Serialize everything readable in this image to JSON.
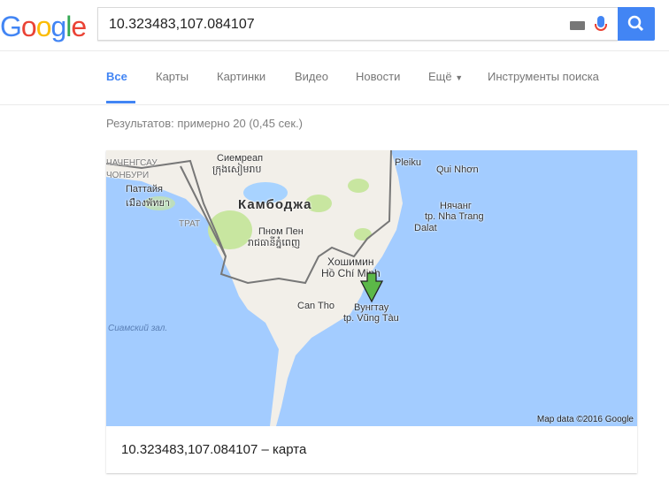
{
  "logo": "Google",
  "search": {
    "value": "10.323483,107.084107"
  },
  "tabs": [
    {
      "label": "Все",
      "active": true
    },
    {
      "label": "Карты"
    },
    {
      "label": "Картинки"
    },
    {
      "label": "Видео"
    },
    {
      "label": "Новости"
    },
    {
      "label": "Ещё"
    },
    {
      "label": "Инструменты поиска"
    }
  ],
  "stats": "Результатов: примерно 20 (0,45 сек.)",
  "map": {
    "labels": {
      "chachoengsao": "ЧАЧЕНГСАУ",
      "chonburi": "ЧОНБУРИ",
      "pattaya": "Паттайя",
      "pattaya_th": "เมืองพัทยา",
      "siemreap": "Сиемреап",
      "siemreap_km": "ក្រុងសៀមរាប",
      "cambodia": "Камбоджа",
      "trat": "ТРАТ",
      "phnompenh": "Пном Пен",
      "phnompenh_km": "រាជធានីភ្នំពេញ",
      "hcm_ru": "Хошимин",
      "hcm": "Hồ Chí Minh",
      "cantho": "Can Tho",
      "vungtau_ru": "Вунгтау",
      "vungtau": "tp. Vũng Tàu",
      "gulf": "Сиамский зал.",
      "pleiku": "Pleiku",
      "quinhon": "Qui Nhơn",
      "nhatrang_ru": "Нячанг",
      "nhatrang": "tp. Nha Trang",
      "dalat": "Dalat"
    },
    "attribution": "Map data ©2016 Google",
    "colors": {
      "water": "#a3ccff",
      "land": "#f2efe9",
      "park": "#c8e6a0",
      "marker": "#5cb848"
    }
  },
  "caption": "10.323483,107.084107 – карта"
}
